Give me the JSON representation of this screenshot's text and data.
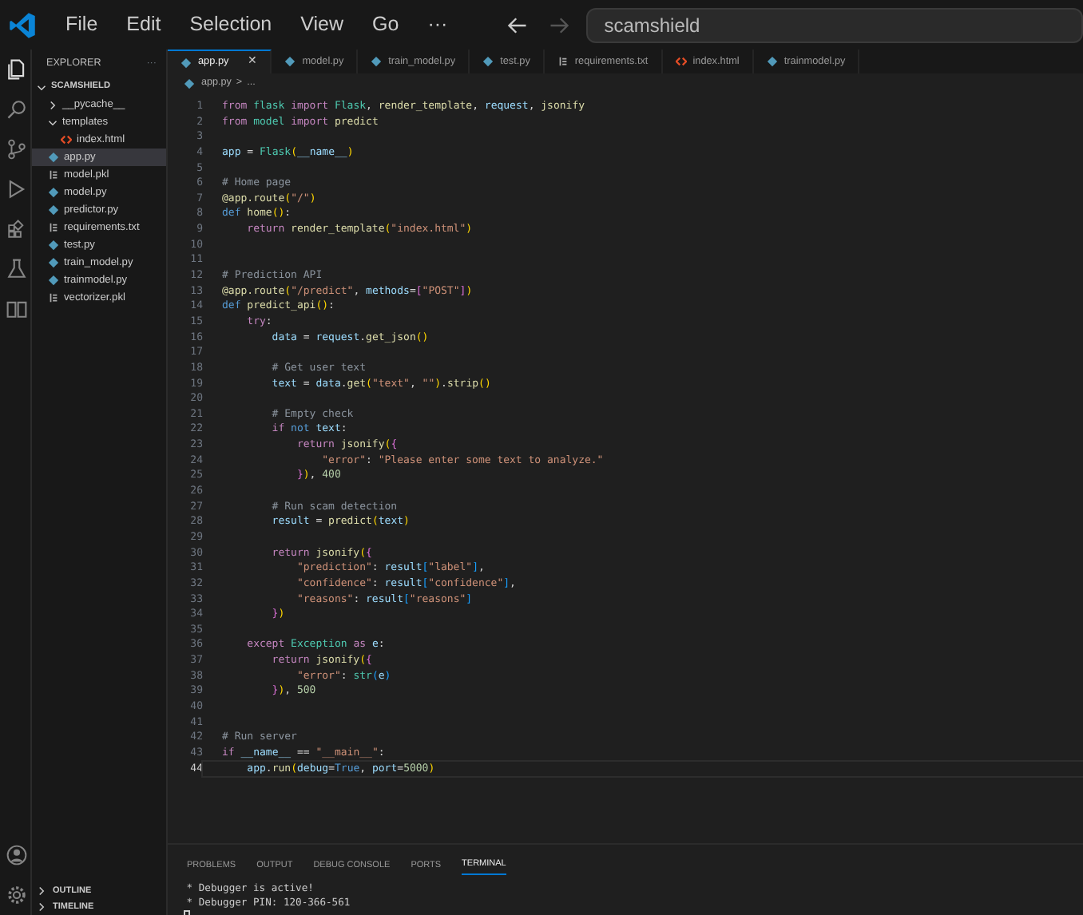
{
  "menu": [
    "File",
    "Edit",
    "Selection",
    "View",
    "Go",
    "···"
  ],
  "nav": {
    "back_disabled": false,
    "forward_disabled": true
  },
  "search": {
    "value": "scamshield"
  },
  "activity": [
    {
      "kind": "files",
      "selected": true
    },
    {
      "kind": "search",
      "selected": false
    },
    {
      "kind": "source",
      "selected": false
    },
    {
      "kind": "debug",
      "selected": false
    },
    {
      "kind": "extensions",
      "selected": false
    },
    {
      "kind": "testing",
      "selected": false
    },
    {
      "kind": "split",
      "selected": false
    }
  ],
  "sidebar": {
    "title": "EXPLORER",
    "more": "···",
    "root": "SCAMSHIELD",
    "items": [
      {
        "name": "__pycache__",
        "kind": "folder",
        "expanded": false,
        "selected": false
      },
      {
        "name": "templates",
        "kind": "folder",
        "expanded": true,
        "selected": false,
        "children": [
          {
            "name": "index.html",
            "kind": "html",
            "selected": false
          }
        ]
      },
      {
        "name": "app.py",
        "kind": "py",
        "selected": true
      },
      {
        "name": "model.pkl",
        "kind": "pkl",
        "selected": false
      },
      {
        "name": "model.py",
        "kind": "py",
        "selected": false
      },
      {
        "name": "predictor.py",
        "kind": "py",
        "selected": false
      },
      {
        "name": "requirements.txt",
        "kind": "txt",
        "selected": false
      },
      {
        "name": "test.py",
        "kind": "py",
        "selected": false
      },
      {
        "name": "train_model.py",
        "kind": "py",
        "selected": false
      },
      {
        "name": "trainmodel.py",
        "kind": "py",
        "selected": false
      },
      {
        "name": "vectorizer.pkl",
        "kind": "pkl",
        "selected": false
      }
    ],
    "sections": [
      "OUTLINE",
      "TIMELINE"
    ]
  },
  "tabs": [
    {
      "label": "app.py",
      "kind": "py",
      "selected": true,
      "close": "✕"
    },
    {
      "label": "model.py",
      "kind": "py",
      "selected": false
    },
    {
      "label": "train_model.py",
      "kind": "py",
      "selected": false
    },
    {
      "label": "test.py",
      "kind": "py",
      "selected": false
    },
    {
      "label": "requirements.txt",
      "kind": "txt",
      "selected": false
    },
    {
      "label": "index.html",
      "kind": "html",
      "selected": false
    },
    {
      "label": "trainmodel.py",
      "kind": "py",
      "selected": false
    }
  ],
  "breadcrumb": {
    "file": "app.py",
    "sep": ">",
    "rest": "..."
  },
  "code": [
    {
      "n": "1",
      "current": false,
      "t": [
        {
          "kind": "k",
          "text": "from "
        },
        {
          "kind": "c",
          "text": "flask "
        },
        {
          "kind": "k",
          "text": "import "
        },
        {
          "kind": "c",
          "text": "Flask"
        },
        {
          "kind": "p",
          "text": ", "
        },
        {
          "kind": "f",
          "text": "render_template"
        },
        {
          "kind": "p",
          "text": ", "
        },
        {
          "kind": "v",
          "text": "request"
        },
        {
          "kind": "p",
          "text": ", "
        },
        {
          "kind": "f",
          "text": "jsonify"
        }
      ]
    },
    {
      "n": "2",
      "current": false,
      "t": [
        {
          "kind": "k",
          "text": "from "
        },
        {
          "kind": "c",
          "text": "model "
        },
        {
          "kind": "k",
          "text": "import "
        },
        {
          "kind": "f",
          "text": "predict"
        }
      ]
    },
    {
      "n": "3",
      "current": false
    },
    {
      "n": "4",
      "current": false,
      "t": [
        {
          "kind": "v",
          "text": "app"
        },
        {
          "kind": "p",
          "text": " = "
        },
        {
          "kind": "c",
          "text": "Flask"
        },
        {
          "kind": "y",
          "text": "("
        },
        {
          "kind": "v",
          "text": "__name__"
        },
        {
          "kind": "y",
          "text": ")"
        }
      ]
    },
    {
      "n": "5",
      "current": false
    },
    {
      "n": "6",
      "current": false,
      "t": [
        {
          "kind": "m",
          "text": "# Home page"
        }
      ]
    },
    {
      "n": "7",
      "current": false,
      "t": [
        {
          "kind": "f",
          "text": "@app.route"
        },
        {
          "kind": "y",
          "text": "("
        },
        {
          "kind": "s",
          "text": "\"/\""
        },
        {
          "kind": "y",
          "text": ")"
        }
      ]
    },
    {
      "n": "8",
      "current": false,
      "t": [
        {
          "kind": "b",
          "text": "def "
        },
        {
          "kind": "f",
          "text": "home"
        },
        {
          "kind": "y",
          "text": "()"
        },
        {
          "kind": "p",
          "text": ":"
        }
      ]
    },
    {
      "n": "9",
      "current": false,
      "t": [
        {
          "kind": "k",
          "text": "    return "
        },
        {
          "kind": "f",
          "text": "render_template"
        },
        {
          "kind": "y",
          "text": "("
        },
        {
          "kind": "s",
          "text": "\"index.html\""
        },
        {
          "kind": "y",
          "text": ")"
        }
      ]
    },
    {
      "n": "10",
      "current": false
    },
    {
      "n": "11",
      "current": false
    },
    {
      "n": "12",
      "current": false,
      "t": [
        {
          "kind": "m",
          "text": "# Prediction API"
        }
      ]
    },
    {
      "n": "13",
      "current": false,
      "t": [
        {
          "kind": "f",
          "text": "@app.route"
        },
        {
          "kind": "y",
          "text": "("
        },
        {
          "kind": "s",
          "text": "\"/predict\""
        },
        {
          "kind": "p",
          "text": ", "
        },
        {
          "kind": "v",
          "text": "methods"
        },
        {
          "kind": "p",
          "text": "="
        },
        {
          "kind": "q",
          "text": "["
        },
        {
          "kind": "s",
          "text": "\"POST\""
        },
        {
          "kind": "q",
          "text": "]"
        },
        {
          "kind": "y",
          "text": ")"
        }
      ]
    },
    {
      "n": "14",
      "current": false,
      "t": [
        {
          "kind": "b",
          "text": "def "
        },
        {
          "kind": "f",
          "text": "predict_api"
        },
        {
          "kind": "y",
          "text": "()"
        },
        {
          "kind": "p",
          "text": ":"
        }
      ]
    },
    {
      "n": "15",
      "current": false,
      "t": [
        {
          "kind": "k",
          "text": "    try"
        },
        {
          "kind": "p",
          "text": ":"
        }
      ]
    },
    {
      "n": "16",
      "current": false,
      "t": [
        {
          "kind": "v",
          "text": "        data"
        },
        {
          "kind": "p",
          "text": " = "
        },
        {
          "kind": "v",
          "text": "request"
        },
        {
          "kind": "p",
          "text": "."
        },
        {
          "kind": "f",
          "text": "get_json"
        },
        {
          "kind": "y",
          "text": "()"
        }
      ]
    },
    {
      "n": "17",
      "current": false
    },
    {
      "n": "18",
      "current": false,
      "t": [
        {
          "kind": "m",
          "text": "        # Get user text"
        }
      ]
    },
    {
      "n": "19",
      "current": false,
      "t": [
        {
          "kind": "v",
          "text": "        text"
        },
        {
          "kind": "p",
          "text": " = "
        },
        {
          "kind": "v",
          "text": "data"
        },
        {
          "kind": "p",
          "text": "."
        },
        {
          "kind": "f",
          "text": "get"
        },
        {
          "kind": "y",
          "text": "("
        },
        {
          "kind": "s",
          "text": "\"text\""
        },
        {
          "kind": "p",
          "text": ", "
        },
        {
          "kind": "s",
          "text": "\"\""
        },
        {
          "kind": "y",
          "text": ")"
        },
        {
          "kind": "p",
          "text": "."
        },
        {
          "kind": "f",
          "text": "strip"
        },
        {
          "kind": "y",
          "text": "()"
        }
      ]
    },
    {
      "n": "20",
      "current": false
    },
    {
      "n": "21",
      "current": false,
      "t": [
        {
          "kind": "m",
          "text": "        # Empty check"
        }
      ]
    },
    {
      "n": "22",
      "current": false,
      "t": [
        {
          "kind": "k",
          "text": "        if "
        },
        {
          "kind": "b",
          "text": "not "
        },
        {
          "kind": "v",
          "text": "text"
        },
        {
          "kind": "p",
          "text": ":"
        }
      ]
    },
    {
      "n": "23",
      "current": false,
      "t": [
        {
          "kind": "k",
          "text": "            return "
        },
        {
          "kind": "f",
          "text": "jsonify"
        },
        {
          "kind": "y",
          "text": "("
        },
        {
          "kind": "q",
          "text": "{"
        }
      ]
    },
    {
      "n": "24",
      "current": false,
      "t": [
        {
          "kind": "s",
          "text": "                \"error\""
        },
        {
          "kind": "p",
          "text": ": "
        },
        {
          "kind": "s",
          "text": "\"Please enter some text to analyze.\""
        }
      ]
    },
    {
      "n": "25",
      "current": false,
      "t": [
        {
          "kind": "q",
          "text": "            }"
        },
        {
          "kind": "y",
          "text": ")"
        },
        {
          "kind": "p",
          "text": ", "
        },
        {
          "kind": "n",
          "text": "400"
        }
      ]
    },
    {
      "n": "26",
      "current": false
    },
    {
      "n": "27",
      "current": false,
      "t": [
        {
          "kind": "m",
          "text": "        # Run scam detection"
        }
      ]
    },
    {
      "n": "28",
      "current": false,
      "t": [
        {
          "kind": "v",
          "text": "        result"
        },
        {
          "kind": "p",
          "text": " = "
        },
        {
          "kind": "f",
          "text": "predict"
        },
        {
          "kind": "y",
          "text": "("
        },
        {
          "kind": "v",
          "text": "text"
        },
        {
          "kind": "y",
          "text": ")"
        }
      ]
    },
    {
      "n": "29",
      "current": false
    },
    {
      "n": "30",
      "current": false,
      "t": [
        {
          "kind": "k",
          "text": "        return "
        },
        {
          "kind": "f",
          "text": "jsonify"
        },
        {
          "kind": "y",
          "text": "("
        },
        {
          "kind": "q",
          "text": "{"
        }
      ]
    },
    {
      "n": "31",
      "current": false,
      "t": [
        {
          "kind": "s",
          "text": "            \"prediction\""
        },
        {
          "kind": "p",
          "text": ": "
        },
        {
          "kind": "v",
          "text": "result"
        },
        {
          "kind": "u",
          "text": "["
        },
        {
          "kind": "s",
          "text": "\"label\""
        },
        {
          "kind": "u",
          "text": "]"
        },
        {
          "kind": "p",
          "text": ","
        }
      ]
    },
    {
      "n": "32",
      "current": false,
      "t": [
        {
          "kind": "s",
          "text": "            \"confidence\""
        },
        {
          "kind": "p",
          "text": ": "
        },
        {
          "kind": "v",
          "text": "result"
        },
        {
          "kind": "u",
          "text": "["
        },
        {
          "kind": "s",
          "text": "\"confidence\""
        },
        {
          "kind": "u",
          "text": "]"
        },
        {
          "kind": "p",
          "text": ","
        }
      ]
    },
    {
      "n": "33",
      "current": false,
      "t": [
        {
          "kind": "s",
          "text": "            \"reasons\""
        },
        {
          "kind": "p",
          "text": ": "
        },
        {
          "kind": "v",
          "text": "result"
        },
        {
          "kind": "u",
          "text": "["
        },
        {
          "kind": "s",
          "text": "\"reasons\""
        },
        {
          "kind": "u",
          "text": "]"
        }
      ]
    },
    {
      "n": "34",
      "current": false,
      "t": [
        {
          "kind": "q",
          "text": "        }"
        },
        {
          "kind": "y",
          "text": ")"
        }
      ]
    },
    {
      "n": "35",
      "current": false
    },
    {
      "n": "36",
      "current": false,
      "t": [
        {
          "kind": "k",
          "text": "    except "
        },
        {
          "kind": "c",
          "text": "Exception "
        },
        {
          "kind": "k",
          "text": "as "
        },
        {
          "kind": "v",
          "text": "e"
        },
        {
          "kind": "p",
          "text": ":"
        }
      ]
    },
    {
      "n": "37",
      "current": false,
      "t": [
        {
          "kind": "k",
          "text": "        return "
        },
        {
          "kind": "f",
          "text": "jsonify"
        },
        {
          "kind": "y",
          "text": "("
        },
        {
          "kind": "q",
          "text": "{"
        }
      ]
    },
    {
      "n": "38",
      "current": false,
      "t": [
        {
          "kind": "s",
          "text": "            \"error\""
        },
        {
          "kind": "p",
          "text": ": "
        },
        {
          "kind": "c",
          "text": "str"
        },
        {
          "kind": "u",
          "text": "("
        },
        {
          "kind": "v",
          "text": "e"
        },
        {
          "kind": "u",
          "text": ")"
        }
      ]
    },
    {
      "n": "39",
      "current": false,
      "t": [
        {
          "kind": "q",
          "text": "        }"
        },
        {
          "kind": "y",
          "text": ")"
        },
        {
          "kind": "p",
          "text": ", "
        },
        {
          "kind": "n",
          "text": "500"
        }
      ]
    },
    {
      "n": "40",
      "current": false
    },
    {
      "n": "41",
      "current": false
    },
    {
      "n": "42",
      "current": false,
      "t": [
        {
          "kind": "m",
          "text": "# Run server"
        }
      ]
    },
    {
      "n": "43",
      "current": false,
      "t": [
        {
          "kind": "k",
          "text": "if "
        },
        {
          "kind": "v",
          "text": "__name__"
        },
        {
          "kind": "p",
          "text": " == "
        },
        {
          "kind": "s",
          "text": "\"__main__\""
        },
        {
          "kind": "p",
          "text": ":"
        }
      ]
    },
    {
      "n": "44",
      "current": true,
      "t": [
        {
          "kind": "v",
          "text": "    app"
        },
        {
          "kind": "p",
          "text": "."
        },
        {
          "kind": "f",
          "text": "run"
        },
        {
          "kind": "y",
          "text": "("
        },
        {
          "kind": "v",
          "text": "debug"
        },
        {
          "kind": "p",
          "text": "="
        },
        {
          "kind": "b",
          "text": "True"
        },
        {
          "kind": "p",
          "text": ", "
        },
        {
          "kind": "v",
          "text": "port"
        },
        {
          "kind": "p",
          "text": "="
        },
        {
          "kind": "n",
          "text": "5000"
        },
        {
          "kind": "y",
          "text": ")"
        }
      ]
    }
  ],
  "panel": {
    "tabs": [
      {
        "label": "PROBLEMS",
        "selected": false
      },
      {
        "label": "OUTPUT",
        "selected": false
      },
      {
        "label": "DEBUG CONSOLE",
        "selected": false
      },
      {
        "label": "PORTS",
        "selected": false
      },
      {
        "label": "TERMINAL",
        "selected": true
      }
    ],
    "lines": [
      " * Debugger is active!",
      " * Debugger PIN: 120-366-561"
    ],
    "cursor": true
  }
}
